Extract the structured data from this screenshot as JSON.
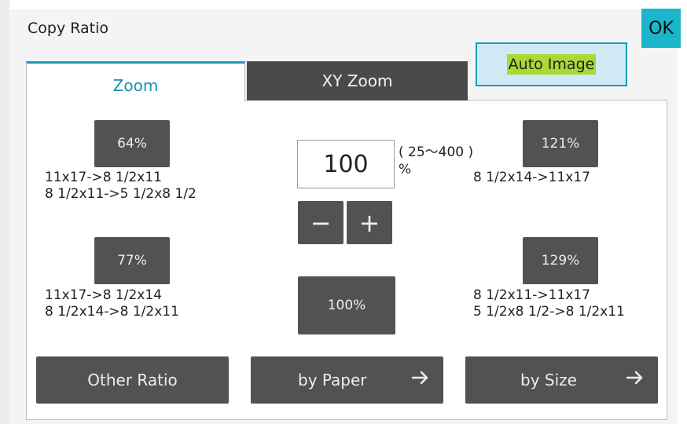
{
  "title": "Copy Ratio",
  "ok_label": "OK",
  "auto_image_label": "Auto Image",
  "tabs": {
    "zoom": "Zoom",
    "xy_zoom": "XY Zoom"
  },
  "presets": {
    "p64": {
      "label": "64%",
      "line1": "11x17->8 1/2x11",
      "line2": "8 1/2x11->5 1/2x8 1/2"
    },
    "p77": {
      "label": "77%",
      "line1": "11x17->8 1/2x14",
      "line2": "8 1/2x14->8 1/2x11"
    },
    "p121": {
      "label": "121%",
      "line1": "8 1/2x14->11x17",
      "line2": ""
    },
    "p129": {
      "label": "129%",
      "line1": "8 1/2x11->11x17",
      "line2": "5 1/2x8 1/2->8 1/2x11"
    }
  },
  "ratio": {
    "value": "100",
    "range_text": "( 25〜400 )",
    "unit": "%",
    "minus": "−",
    "plus": "+",
    "reset_label": "100%"
  },
  "bottom": {
    "other_ratio": "Other Ratio",
    "by_paper": "by Paper",
    "by_size": "by Size"
  }
}
